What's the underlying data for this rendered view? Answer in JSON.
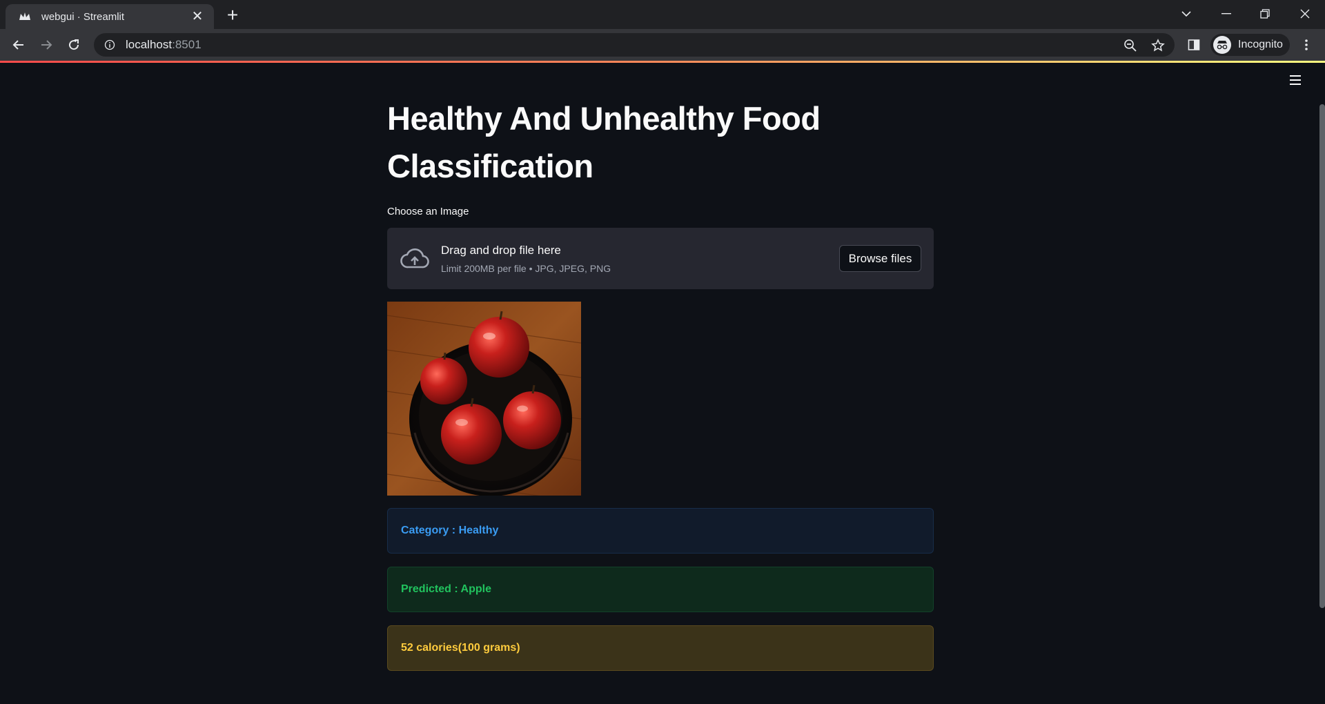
{
  "browser": {
    "tab_title": "webgui · Streamlit",
    "url_host": "localhost",
    "url_port": ":8501",
    "profile_label": "Incognito"
  },
  "app": {
    "title": "Healthy And Unhealthy Food Classification",
    "uploader": {
      "label": "Choose an Image",
      "drop_text": "Drag and drop file here",
      "limit_text": "Limit 200MB per file • JPG, JPEG, PNG",
      "browse_label": "Browse files"
    },
    "uploaded_image_subject": "bowl of red apples",
    "results": {
      "category": "Category : Healthy",
      "predicted": "Predicted : Apple",
      "calories": "52 calories(100 grams)"
    }
  },
  "colors": {
    "background": "#0e1117",
    "info": "#3a9cf3",
    "success": "#21c35e",
    "warning": "#ffcc3d"
  },
  "icons": {
    "favicon": "streamlit-crown-icon",
    "upload": "cloud-upload-icon",
    "menu": "hamburger-menu-icon"
  }
}
